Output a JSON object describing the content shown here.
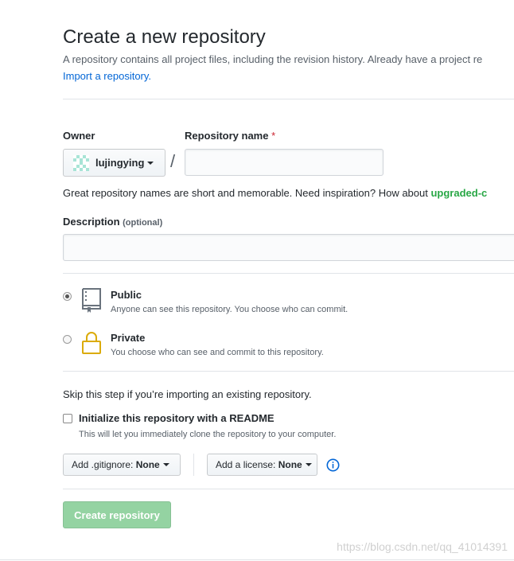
{
  "header": {
    "title": "Create a new repository",
    "subtitle": "A repository contains all project files, including the revision history. Already have a project re",
    "import_link": "Import a repository."
  },
  "owner": {
    "label": "Owner",
    "value": "lujingying",
    "separator": "/"
  },
  "repo_name": {
    "label": "Repository name",
    "required_mark": "*",
    "value": ""
  },
  "suggestion": {
    "text": "Great repository names are short and memorable. Need inspiration? How about ",
    "name": "upgraded-c"
  },
  "description": {
    "label": "Description",
    "optional": "(optional)",
    "value": ""
  },
  "visibility": {
    "selected": "Public",
    "options": [
      {
        "title": "Public",
        "note": "Anyone can see this repository. You choose who can commit.",
        "icon": "repo-book-icon"
      },
      {
        "title": "Private",
        "note": "You choose who can see and commit to this repository.",
        "icon": "lock-icon"
      }
    ]
  },
  "init": {
    "skip_text": "Skip this step if you’re importing an existing repository.",
    "readme_label": "Initialize this repository with a README",
    "readme_note": "This will let you immediately clone the repository to your computer.",
    "readme_checked": false
  },
  "gitignore": {
    "label": "Add .gitignore:",
    "value": "None"
  },
  "license": {
    "label": "Add a license:",
    "value": "None"
  },
  "submit_label": "Create repository",
  "watermark": "https://blog.csdn.net/qq_41014391",
  "colors": {
    "link": "#0366d6",
    "suggestion": "#28a745",
    "create_disabled": "#94d3a2",
    "required": "#cb2431",
    "lock": "#dbab09"
  }
}
